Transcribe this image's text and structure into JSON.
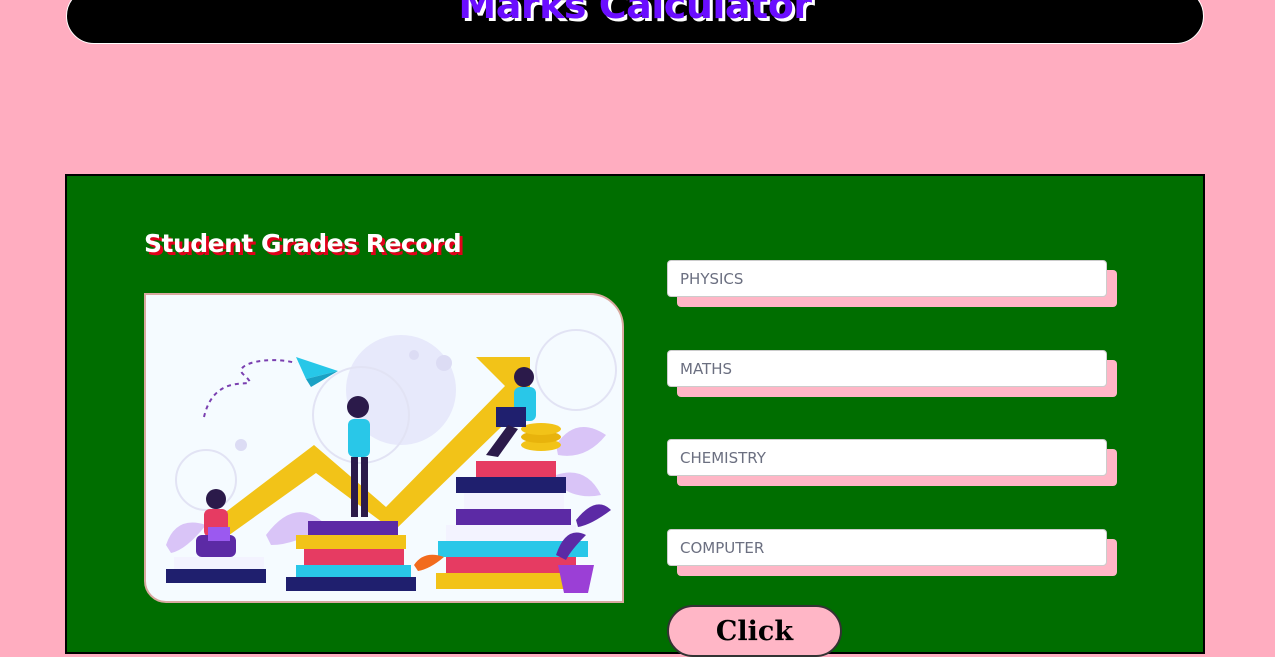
{
  "header": {
    "title": "Marks Calculator"
  },
  "panel": {
    "title": "Student Grades Record"
  },
  "illustration": {
    "icon": "students-growth-illustration"
  },
  "fields": [
    {
      "placeholder": "PHYSICS",
      "value": ""
    },
    {
      "placeholder": "MATHS",
      "value": ""
    },
    {
      "placeholder": "CHEMISTRY",
      "value": ""
    },
    {
      "placeholder": "COMPUTER",
      "value": ""
    }
  ],
  "actions": {
    "click_label": "Click"
  },
  "colors": {
    "page_background": "#ffadc0",
    "panel_background": "#006e00",
    "title_color": "#6a0dff",
    "title_shadow": "#e0001a",
    "field_shadow": "#ffb6c6"
  }
}
